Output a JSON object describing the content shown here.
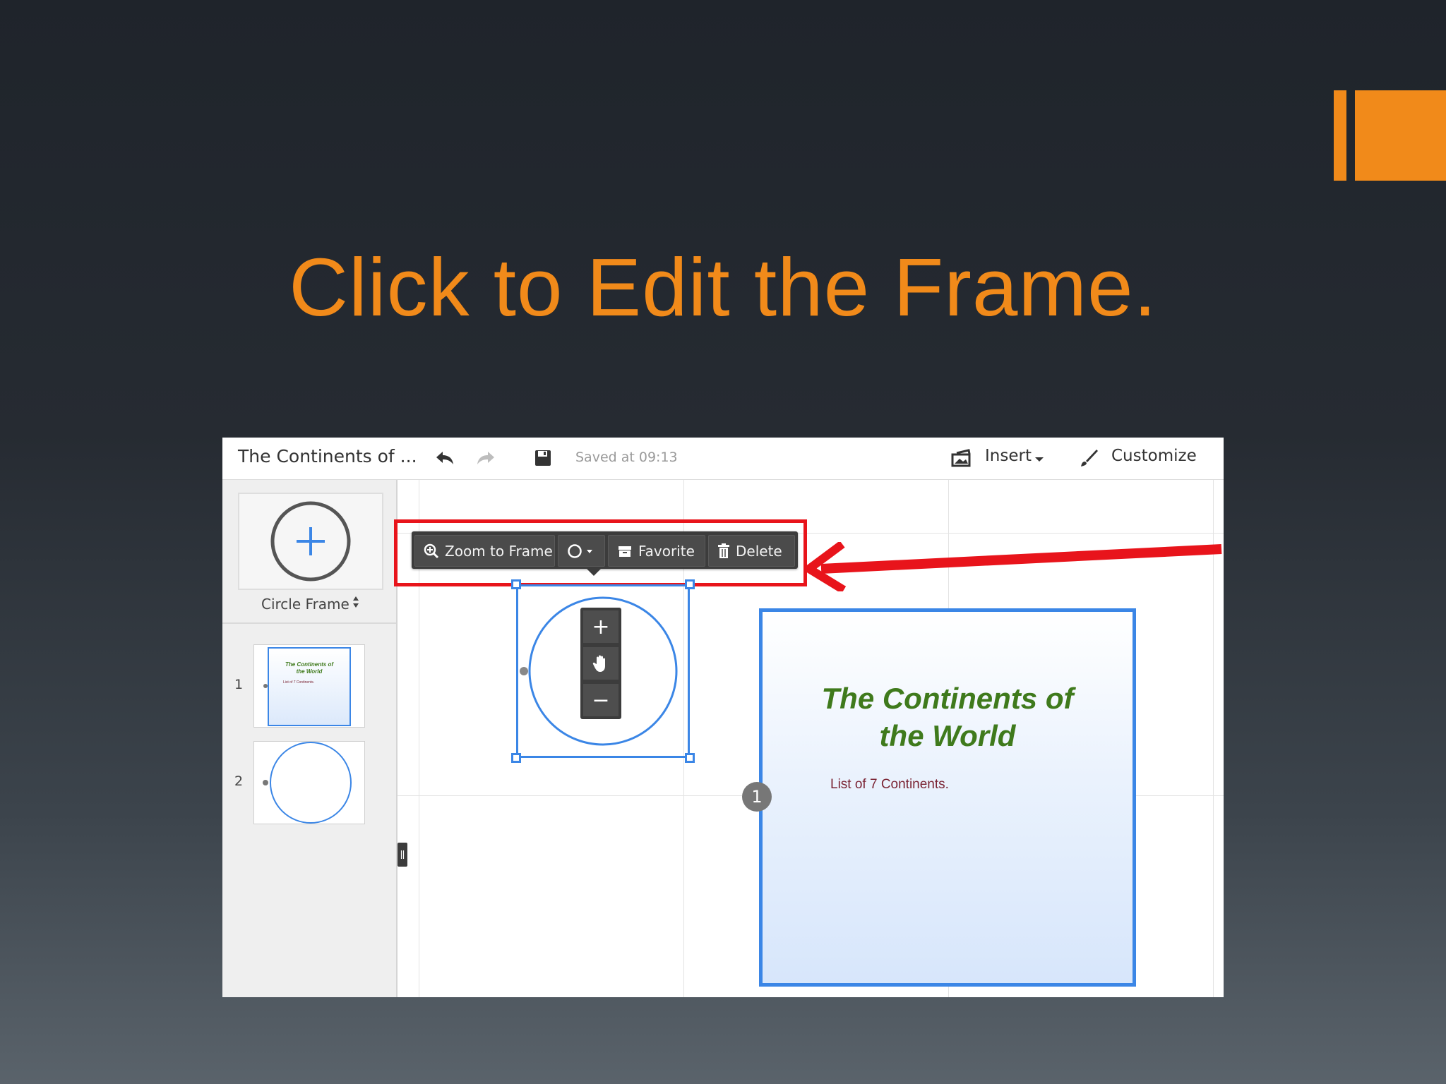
{
  "slide": {
    "title": "Click to Edit the Frame."
  },
  "app": {
    "doc_title": "The Continents of ...",
    "saved_status": "Saved at 09:13",
    "insert_label": "Insert",
    "customize_label": "Customize"
  },
  "sidebar": {
    "frame_type_label": "Circle Frame",
    "thumbnails": [
      {
        "number": "1",
        "title_line1": "The Continents of",
        "title_line2": "the World",
        "sub": "List of 7 Continents."
      },
      {
        "number": "2"
      }
    ]
  },
  "toolbar": {
    "zoom_to_frame": "Zoom to Frame",
    "favorite": "Favorite",
    "delete": "Delete"
  },
  "zoom_controls": {
    "plus": "+",
    "minus": "−"
  },
  "frame": {
    "title_line1": "The Continents of",
    "title_line2": "the World",
    "subtitle": "List of 7 Continents.",
    "number": "1"
  },
  "colors": {
    "accent_orange": "#f18a1a",
    "highlight_red": "#e8141b",
    "selection_blue": "#3b86e6",
    "frame_title_green": "#3f7a1c"
  },
  "icons": {
    "undo": "undo-icon",
    "redo": "redo-icon",
    "save": "save-icon",
    "insert": "insert-icon",
    "customize": "brush-icon",
    "zoom": "zoom-in-icon",
    "shape": "circle-shape-icon",
    "favorite": "favorite-icon",
    "delete": "trash-icon",
    "pan": "hand-icon"
  }
}
